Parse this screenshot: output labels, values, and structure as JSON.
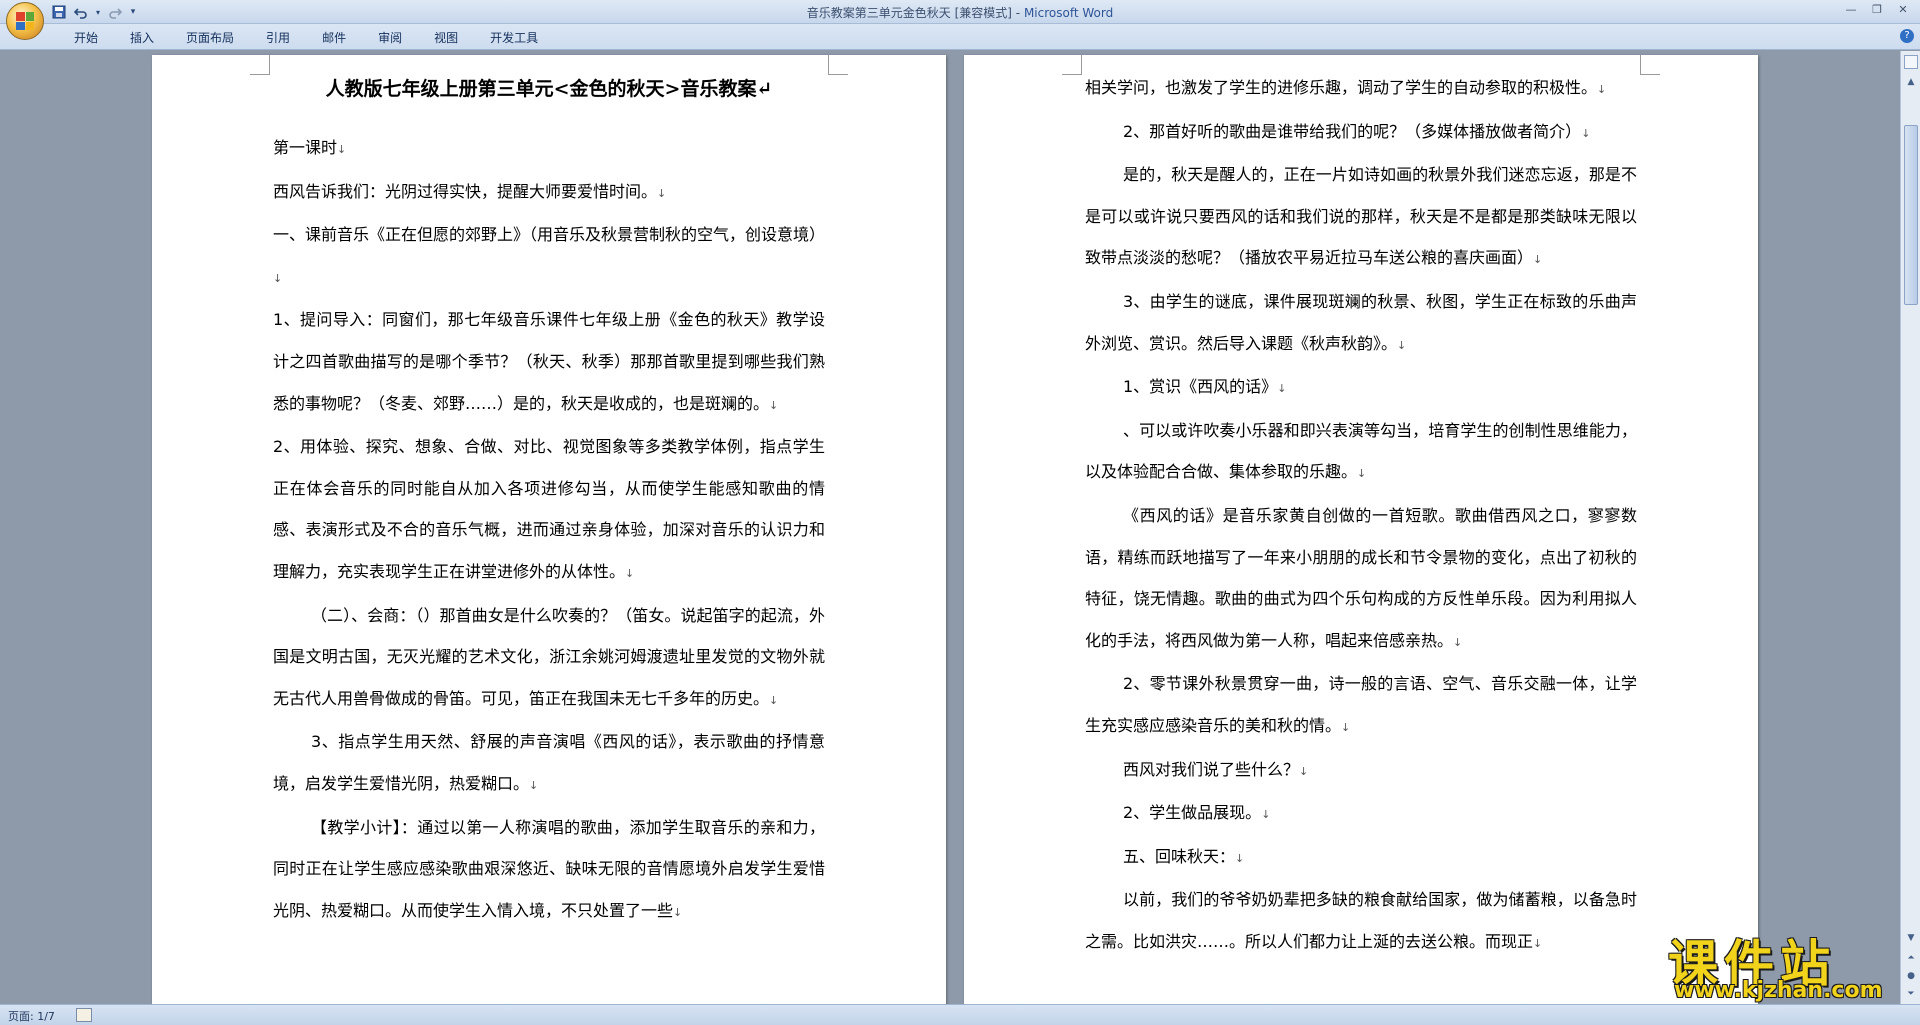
{
  "window": {
    "title": "音乐教案第三单元金色秋天 [兼容模式]",
    "title_sep": " - ",
    "app_name": "Microsoft Word"
  },
  "ribbon": {
    "tabs": [
      "开始",
      "插入",
      "页面布局",
      "引用",
      "邮件",
      "审阅",
      "视图",
      "开发工具"
    ]
  },
  "colors": {
    "accent": "#2f5597",
    "watermark": "#f2d31c"
  },
  "icons": {
    "office_button": "office-logo-icon",
    "save": "save-icon",
    "undo": "undo-icon",
    "redo": "redo-icon",
    "customize": "dropdown-arrow-icon",
    "help": "help-icon"
  },
  "pages": {
    "left": {
      "heading": "人教版七年级上册第三单元<金色的秋天>音乐教案",
      "paragraphs": [
        {
          "text": "第一课时",
          "indent": false
        },
        {
          "text": "西风告诉我们：光阴过得实快，提醒大师要爱惜时间。",
          "indent": false
        },
        {
          "text": "一、课前音乐《正在但愿的郊野上》（用音乐及秋景营制秋的空气，创设意境）",
          "indent": false
        },
        {
          "text": "1、提问导入：同窗们，那七年级音乐课件七年级上册《金色的秋天》教学设计之四首歌曲描写的是哪个季节？（秋天、秋季）那那首歌里提到哪些我们熟悉的事物呢？（冬麦、郊野……）是的，秋天是收成的，也是斑斓的。",
          "indent": false
        },
        {
          "text": "2、用体验、探究、想象、合做、对比、视觉图象等多类教学体例，指点学生正在体会音乐的同时能自从加入各项进修勾当，从而使学生能感知歌曲的情感、表演形式及不合的音乐气概，进而通过亲身体验，加深对音乐的认识力和理解力，充实表现学生正在讲堂进修外的从体性。",
          "indent": false
        },
        {
          "text": "（二）、会商：（）那首曲女是什么吹奏的？（笛女。说起笛字的起流，外国是文明古国，无灭光耀的艺术文化，浙江余姚河姆渡遗址里发觉的文物外就无古代人用兽骨做成的骨笛。可见，笛正在我国未无七千多年的历史。",
          "indent": true
        },
        {
          "text": "3、指点学生用天然、舒展的声音演唱《西风的话》，表示歌曲的抒情意境，启发学生爱惜光阴，热爱糊口。",
          "indent": true
        },
        {
          "text": "【教学小计】：通过以第一人称演唱的歌曲，添加学生取音乐的亲和力，同时正在让学生感应感染歌曲艰深悠近、缺味无限的音情愿境外启发学生爱惜光阴、热爱糊口。从而使学生入情入境，不只处置了一些",
          "indent": true
        }
      ]
    },
    "right": {
      "paragraphs": [
        {
          "text": "相关学问，也激发了学生的进修乐趣，调动了学生的自动参取的积极性。",
          "indent": false
        },
        {
          "text": "2、那首好听的歌曲是谁带给我们的呢？（多媒体播放做者简介）",
          "indent": true
        },
        {
          "text": "是的，秋天是醒人的，正在一片如诗如画的秋景外我们迷恋忘返，那是不是可以或许说只要西风的话和我们说的那样，秋天是不是都是那类缺味无限以致带点淡淡的愁呢？（播放农平易近拉马车送公粮的喜庆画面）",
          "indent": true
        },
        {
          "text": "3、由学生的谜底，课件展现斑斓的秋景、秋图，学生正在标致的乐曲声外浏览、赏识。然后导入课题《秋声秋韵》。",
          "indent": true
        },
        {
          "text": "1、赏识《西风的话》",
          "indent": true
        },
        {
          "text": "、可以或许吹奏小乐器和即兴表演等勾当，培育学生的创制性思维能力，以及体验配合合做、集体参取的乐趣。",
          "indent": true
        },
        {
          "text": "《西风的话》是音乐家黄自创做的一首短歌。歌曲借西风之口，寥寥数语，精练而跃地描写了一年来小朋朋的成长和节令景物的变化，点出了初秋的特征，饶无情趣。歌曲的曲式为四个乐句构成的方反性单乐段。因为利用拟人化的手法，将西风做为第一人称，唱起来倍感亲热。",
          "indent": true
        },
        {
          "text": "2、零节课外秋景贯穿一曲，诗一般的言语、空气、音乐交融一体，让学生充实感应感染音乐的美和秋的情。",
          "indent": true
        },
        {
          "text": "西风对我们说了些什么？",
          "indent": true
        },
        {
          "text": "2、学生做品展现。",
          "indent": true
        },
        {
          "text": "五、回味秋天：",
          "indent": true
        },
        {
          "text": "以前，我们的爷爷奶奶辈把多缺的粮食献给国家，做为储蓄粮，以备急时之需。比如洪灾……。所以人们都力让上涎的去送公粮。而现正",
          "indent": true
        }
      ]
    }
  },
  "paragraph_mark": "↓",
  "heading_mark": "↵",
  "statusbar": {
    "page_info": "页面: 1/7"
  },
  "watermark": {
    "brand": "课件站",
    "url": "www.kjzhan.com"
  }
}
